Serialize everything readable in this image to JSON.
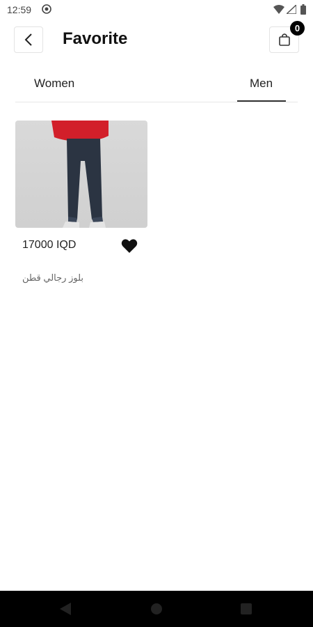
{
  "status_bar": {
    "time": "12:59"
  },
  "header": {
    "title": "Favorite",
    "cart_count": "0"
  },
  "tabs": [
    {
      "label": "Women",
      "selected": false
    },
    {
      "label": "Men",
      "selected": true
    }
  ],
  "products": [
    {
      "price": "17000 IQD",
      "name": "بلوز رجالي قطن",
      "favorited": true
    }
  ],
  "colors": {
    "accent": "#000000",
    "indicator": "#333333"
  }
}
